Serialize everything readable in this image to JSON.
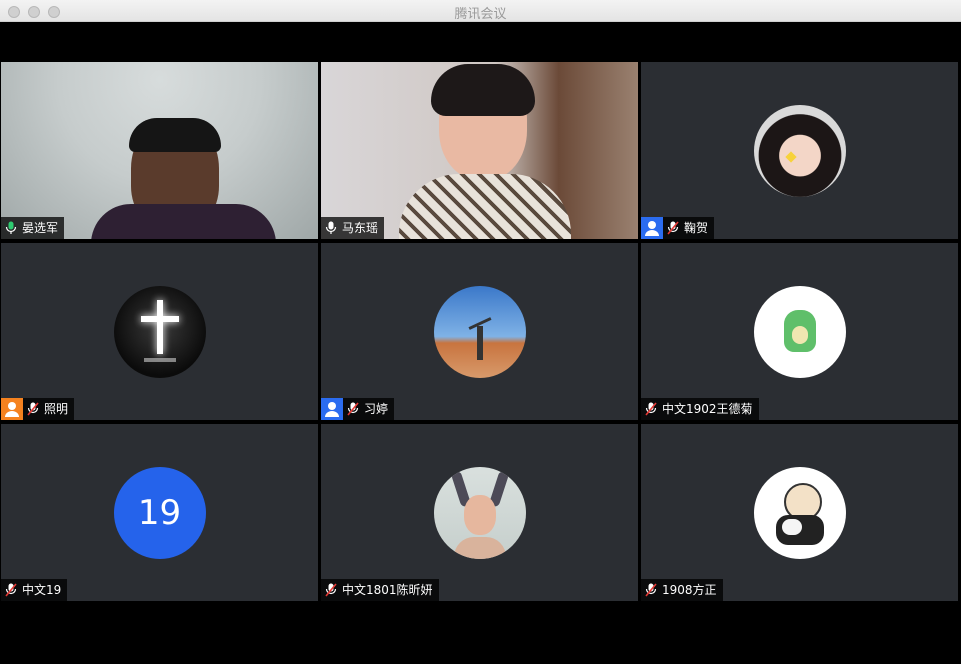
{
  "window": {
    "title": "腾讯会议"
  },
  "participants": [
    {
      "name": "晏选军",
      "mic": "active"
    },
    {
      "name": "马东瑶",
      "mic": "on"
    },
    {
      "name": "鞠贺",
      "mic": "muted",
      "badge": "blue"
    },
    {
      "name": "照明",
      "mic": "muted",
      "badge": "orange"
    },
    {
      "name": "习婷",
      "mic": "muted",
      "badge": "blue"
    },
    {
      "name": "中文1902王德菊",
      "mic": "muted"
    },
    {
      "name": "中文19",
      "mic": "muted",
      "avatar_text": "19"
    },
    {
      "name": "中文1801陈昕妍",
      "mic": "muted"
    },
    {
      "name": "1908方正",
      "mic": "muted"
    }
  ],
  "colors": {
    "active_border": "#22c55e",
    "badge_blue": "#2b6cf0",
    "badge_orange": "#f5821f",
    "tile_bg": "#2b2e33",
    "mic_muted": "#e53935"
  }
}
